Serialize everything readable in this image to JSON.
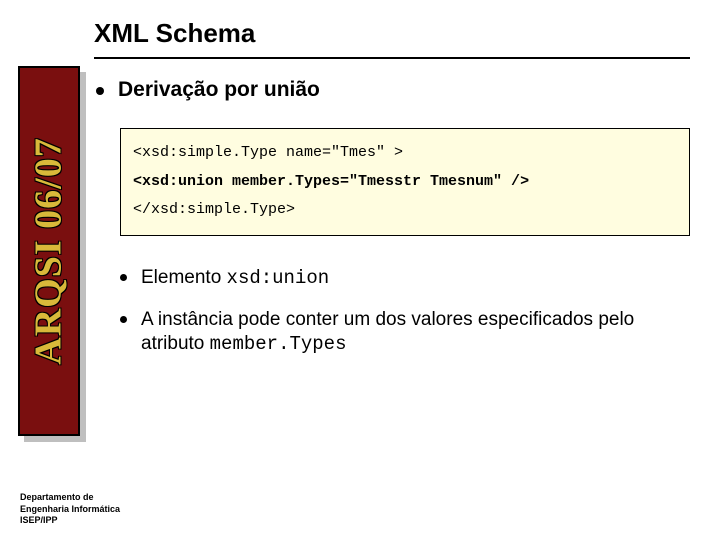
{
  "title": "XML Schema",
  "sidebar": "ARQSI 06/07",
  "heading": "Derivação por união",
  "code": {
    "line1": "<xsd:simple.Type name=\"Tmes\" >",
    "line2": "<xsd:union member.Types=\"Tmesstr Tmesnum\" />",
    "line3": "</xsd:simple.Type>"
  },
  "bullets": {
    "b1_pre": "Elemento ",
    "b1_code": "xsd:union",
    "b2_pre": "A instância pode conter um dos valores especificados pelo atributo ",
    "b2_code": "member.Types"
  },
  "footer": {
    "l1": "Departamento de",
    "l2": "Engenharia Informática",
    "l3": "ISEP/IPP"
  }
}
